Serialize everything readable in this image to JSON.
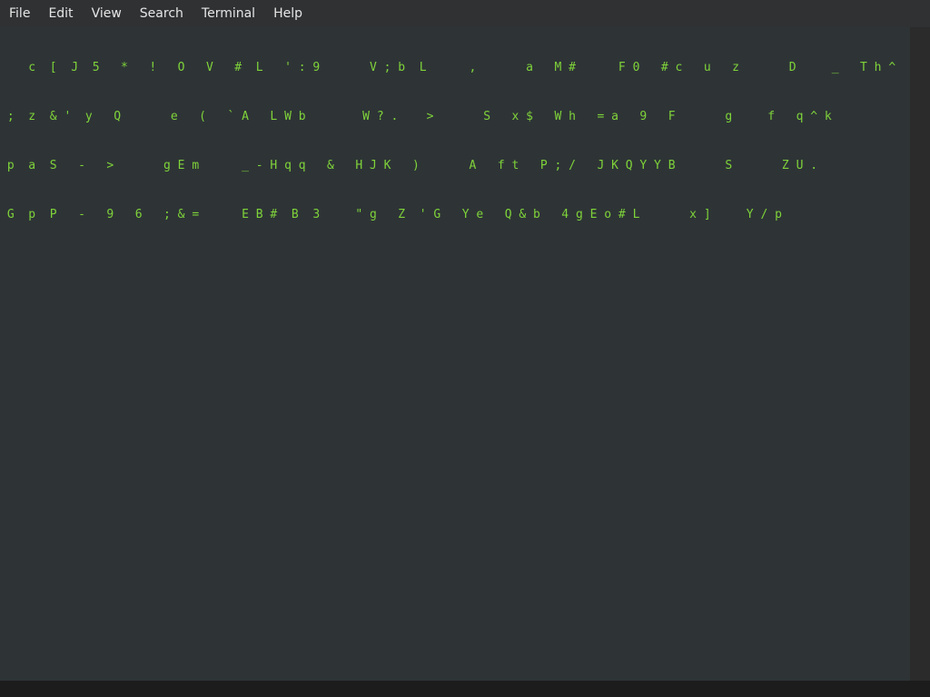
{
  "menu": {
    "file": "File",
    "edit": "Edit",
    "view": "View",
    "search": "Search",
    "terminal": "Terminal",
    "help": "Help"
  },
  "rain": {
    "rows": [
      "    c  [  J  5   *   !   O   V   #  L   ' : 9       V ; b  L      ,       a   M #      F 0   # c   u   z       D     _   T h ^",
      " ;  z  & '  y   Q       e   (   ` A   L W b        W ? .    >       S   x $   W h   = a   9   F       g     f   q ^ k",
      " p  a  S   -   >       g E m      _ - H q q   &   H J K   )       A   f t   P ; /   J K Q Y Y B       S       Z U .",
      " G  p  P   -   9   6   ; & =      E B #  B  3     \" g   Z  ' G   Y e   Q & b   4 g E o # L       x ]     Y / p"
    ]
  }
}
